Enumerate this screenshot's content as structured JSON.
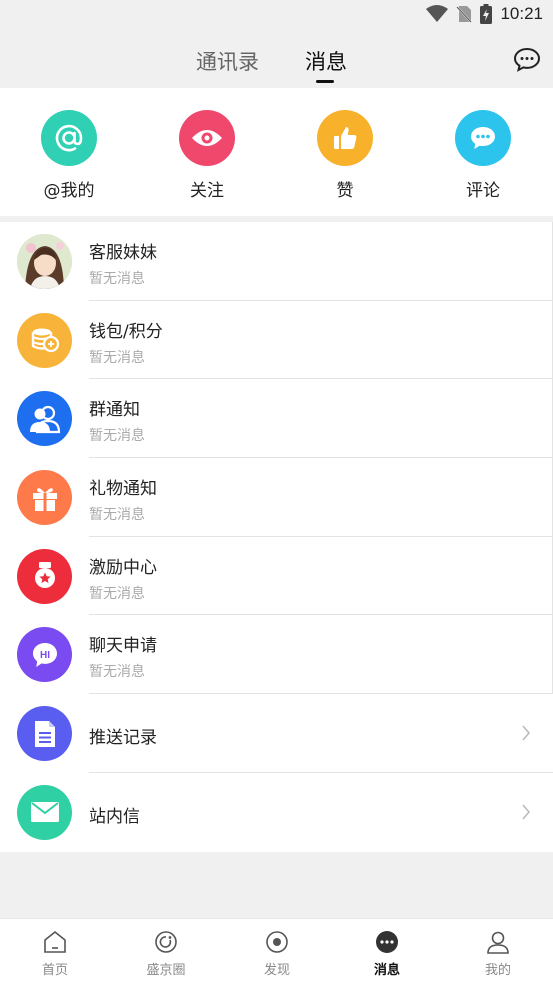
{
  "status": {
    "time": "10:21",
    "icons": [
      "wifi-icon",
      "no-sim-icon",
      "battery-charging-icon"
    ]
  },
  "header": {
    "tabs": [
      {
        "label": "通讯录",
        "active": false
      },
      {
        "label": "消息",
        "active": true
      }
    ],
    "right_icon": "chat-bubbles-icon"
  },
  "quick": [
    {
      "label": "@我的",
      "icon": "at-icon",
      "color": "#2fd0b4"
    },
    {
      "label": "关注",
      "icon": "eye-icon",
      "color": "#f0476d"
    },
    {
      "label": "赞",
      "icon": "thumbs-up-icon",
      "color": "#f7b12a"
    },
    {
      "label": "评论",
      "icon": "comment-icon",
      "color": "#2cc4ec"
    }
  ],
  "messages": [
    {
      "title": "客服妹妹",
      "sub": "暂无消息",
      "icon": "customer-service-avatar",
      "color": "#e8d9c4"
    },
    {
      "title": "钱包/积分",
      "sub": "暂无消息",
      "icon": "coins-icon",
      "color": "#f8b43a"
    },
    {
      "title": "群通知",
      "sub": "暂无消息",
      "icon": "group-icon",
      "color": "#1e6ff0"
    },
    {
      "title": "礼物通知",
      "sub": "暂无消息",
      "icon": "gift-icon",
      "color": "#ff7a4a"
    },
    {
      "title": "激励中心",
      "sub": "暂无消息",
      "icon": "medal-icon",
      "color": "#ee2d3c"
    },
    {
      "title": "聊天申请",
      "sub": "暂无消息",
      "icon": "hi-chat-icon",
      "color": "#7a4bf0"
    }
  ],
  "links": [
    {
      "title": "推送记录",
      "icon": "document-icon",
      "color": "#5a5ef0"
    },
    {
      "title": "站内信",
      "icon": "envelope-icon",
      "color": "#2fd0a4"
    }
  ],
  "nav": [
    {
      "label": "首页",
      "icon": "home-icon",
      "active": false
    },
    {
      "label": "盛京圈",
      "icon": "circle-refresh-icon",
      "active": false
    },
    {
      "label": "发现",
      "icon": "discover-icon",
      "active": false
    },
    {
      "label": "消息",
      "icon": "message-dots-icon",
      "active": true
    },
    {
      "label": "我的",
      "icon": "person-icon",
      "active": false
    }
  ]
}
